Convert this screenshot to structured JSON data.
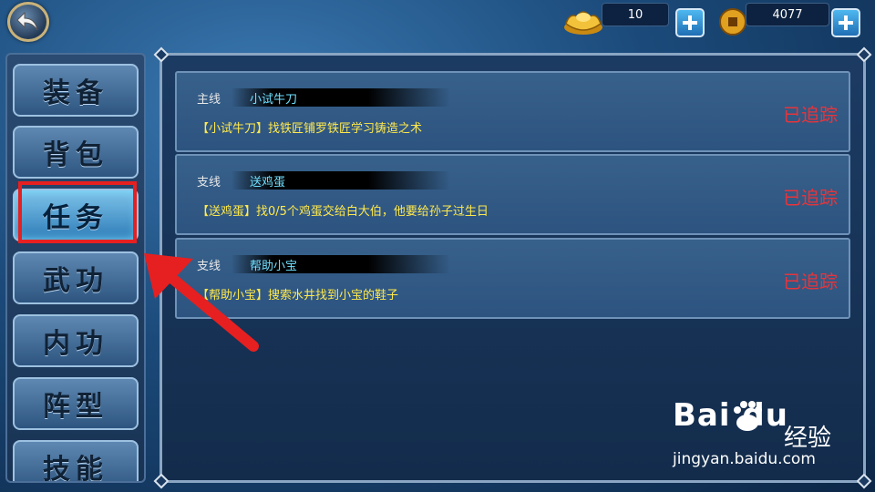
{
  "topbar": {
    "gold_value": "10",
    "coin_value": "4077"
  },
  "sidebar": {
    "items": [
      {
        "label": "装备"
      },
      {
        "label": "背包"
      },
      {
        "label": "任务"
      },
      {
        "label": "武功"
      },
      {
        "label": "内功"
      },
      {
        "label": "阵型"
      },
      {
        "label": "技能"
      }
    ],
    "active_index": 2
  },
  "quests": [
    {
      "type": "主线",
      "name": "小试牛刀",
      "desc": "【小试牛刀】找铁匠铺罗铁匠学习铸造之术",
      "status": "已追踪"
    },
    {
      "type": "支线",
      "name": "送鸡蛋",
      "desc": "【送鸡蛋】找0/5个鸡蛋交给白大伯，他要给孙子过生日",
      "status": "已追踪"
    },
    {
      "type": "支线",
      "name": "帮助小宝",
      "desc": "【帮助小宝】搜索水井找到小宝的鞋子",
      "status": "已追踪"
    }
  ],
  "watermark": {
    "brand": "Bai du",
    "brand_cn": "经验",
    "url": "jingyan.baidu.com"
  },
  "colors": {
    "highlight": "#e62020",
    "status": "#e8343a",
    "quest_name": "#6fe0ff",
    "quest_desc": "#ffe94d"
  }
}
